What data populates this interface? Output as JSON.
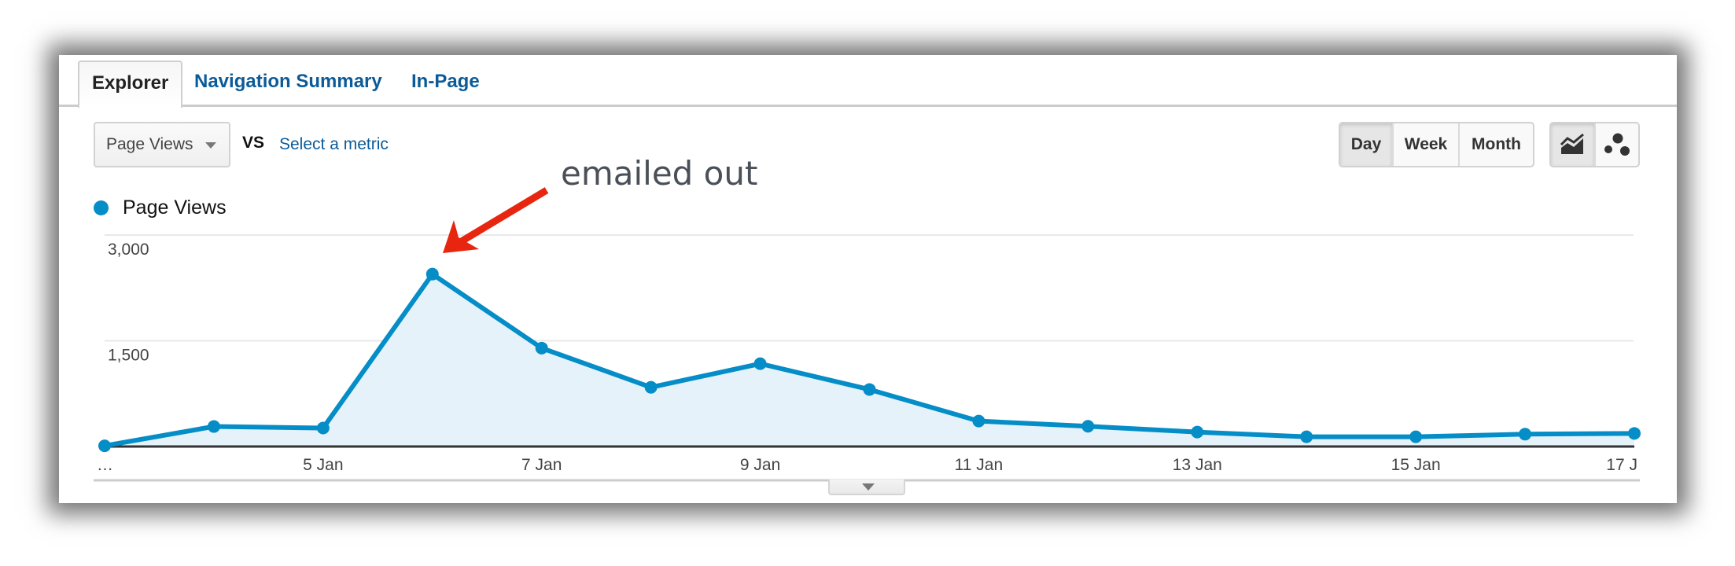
{
  "tabs": [
    {
      "label": "Explorer",
      "active": true
    },
    {
      "label": "Navigation Summary",
      "active": false
    },
    {
      "label": "In-Page",
      "active": false
    }
  ],
  "controls": {
    "metric_select": {
      "value": "Page Views"
    },
    "vs_label": "VS",
    "select_metric_link": "Select a metric",
    "granularity": [
      {
        "label": "Day",
        "active": true
      },
      {
        "label": "Week",
        "active": false
      },
      {
        "label": "Month",
        "active": false
      }
    ],
    "chart_type": [
      {
        "icon": "line-chart-icon",
        "active": true
      },
      {
        "icon": "motion-chart-icon",
        "active": false
      }
    ]
  },
  "annotation": {
    "text": "emailed out",
    "points_to": "6 Jan",
    "color": "#e8260f"
  },
  "colors": {
    "series": "#058dc7",
    "fill": "#e5f2f9",
    "grid": "#e8e8e8",
    "axis": "#333333",
    "link": "#0b5b99"
  },
  "chart_data": {
    "type": "area",
    "title": "",
    "legend": [
      "Page Views"
    ],
    "legend_position": "top-left",
    "x": [
      "3 Jan",
      "4 Jan",
      "5 Jan",
      "6 Jan",
      "7 Jan",
      "8 Jan",
      "9 Jan",
      "10 Jan",
      "11 Jan",
      "12 Jan",
      "13 Jan",
      "14 Jan",
      "15 Jan",
      "16 Jan",
      "17 Jan"
    ],
    "series": [
      {
        "name": "Page Views",
        "values": [
          10,
          284,
          262,
          2446,
          1396,
          840,
          1175,
          809,
          361,
          287,
          205,
          138,
          138,
          175,
          186
        ]
      }
    ],
    "x_tick_labels": [
      "…",
      "5 Jan",
      "7 Jan",
      "9 Jan",
      "11 Jan",
      "13 Jan",
      "15 Jan",
      "17 J"
    ],
    "x_tick_indices": [
      0,
      2,
      4,
      6,
      8,
      10,
      12,
      14
    ],
    "y_tick_labels": [
      "3,000",
      "1,500"
    ],
    "y_tick_values": [
      3000,
      1500
    ],
    "ylim": [
      0,
      3000
    ],
    "xlabel": "",
    "ylabel": "",
    "grid": true
  }
}
